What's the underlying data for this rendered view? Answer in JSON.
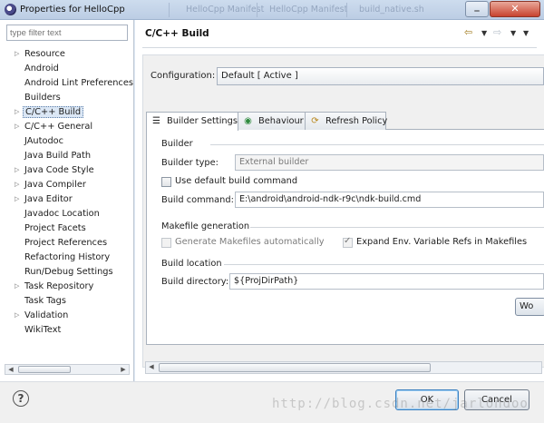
{
  "window": {
    "title": "Properties for HelloCpp",
    "background_tabs": [
      "HelloCpp Manifest",
      "HelloCpp Manifest",
      "build_native.sh"
    ],
    "close_glyph": "✕",
    "minimize_glyph": "_"
  },
  "left": {
    "filter_placeholder": "type filter text",
    "tree": [
      {
        "label": "Resource",
        "expandable": true
      },
      {
        "label": "Android",
        "expandable": false
      },
      {
        "label": "Android Lint Preferences",
        "expandable": false
      },
      {
        "label": "Builders",
        "expandable": false
      },
      {
        "label": "C/C++ Build",
        "expandable": true,
        "selected": true
      },
      {
        "label": "C/C++ General",
        "expandable": true
      },
      {
        "label": "JAutodoc",
        "expandable": false
      },
      {
        "label": "Java Build Path",
        "expandable": false
      },
      {
        "label": "Java Code Style",
        "expandable": true
      },
      {
        "label": "Java Compiler",
        "expandable": true
      },
      {
        "label": "Java Editor",
        "expandable": true
      },
      {
        "label": "Javadoc Location",
        "expandable": false
      },
      {
        "label": "Project Facets",
        "expandable": false
      },
      {
        "label": "Project References",
        "expandable": false
      },
      {
        "label": "Refactoring History",
        "expandable": false
      },
      {
        "label": "Run/Debug Settings",
        "expandable": false
      },
      {
        "label": "Task Repository",
        "expandable": true
      },
      {
        "label": "Task Tags",
        "expandable": false
      },
      {
        "label": "Validation",
        "expandable": true
      },
      {
        "label": "WikiText",
        "expandable": false
      }
    ]
  },
  "main": {
    "title": "C/C++ Build",
    "configuration_label": "Configuration:",
    "configuration_value": "Default  [ Active ]",
    "tabs": [
      {
        "label": "Builder Settings",
        "icon": "builder-settings-icon"
      },
      {
        "label": "Behaviour",
        "icon": "behaviour-icon"
      },
      {
        "label": "Refresh Policy",
        "icon": "refresh-policy-icon"
      }
    ],
    "builder": {
      "section": "Builder",
      "type_label": "Builder type:",
      "type_value": "External builder",
      "use_default_label": "Use default build command",
      "use_default_checked": false,
      "command_label": "Build command:",
      "command_value": "E:\\android\\android-ndk-r9c\\ndk-build.cmd"
    },
    "makefile": {
      "section": "Makefile generation",
      "generate_label": "Generate Makefiles automatically",
      "generate_checked": false,
      "expand_label": "Expand Env. Variable Refs in Makefiles",
      "expand_checked": true
    },
    "location": {
      "section": "Build location",
      "dir_label": "Build directory:",
      "dir_value": "${ProjDirPath}",
      "workspace_button": "Wo"
    }
  },
  "buttons": {
    "help": "?",
    "ok": "OK",
    "cancel": "Cancel"
  },
  "watermark": "http://blog.csdn.net/jarlondoo"
}
